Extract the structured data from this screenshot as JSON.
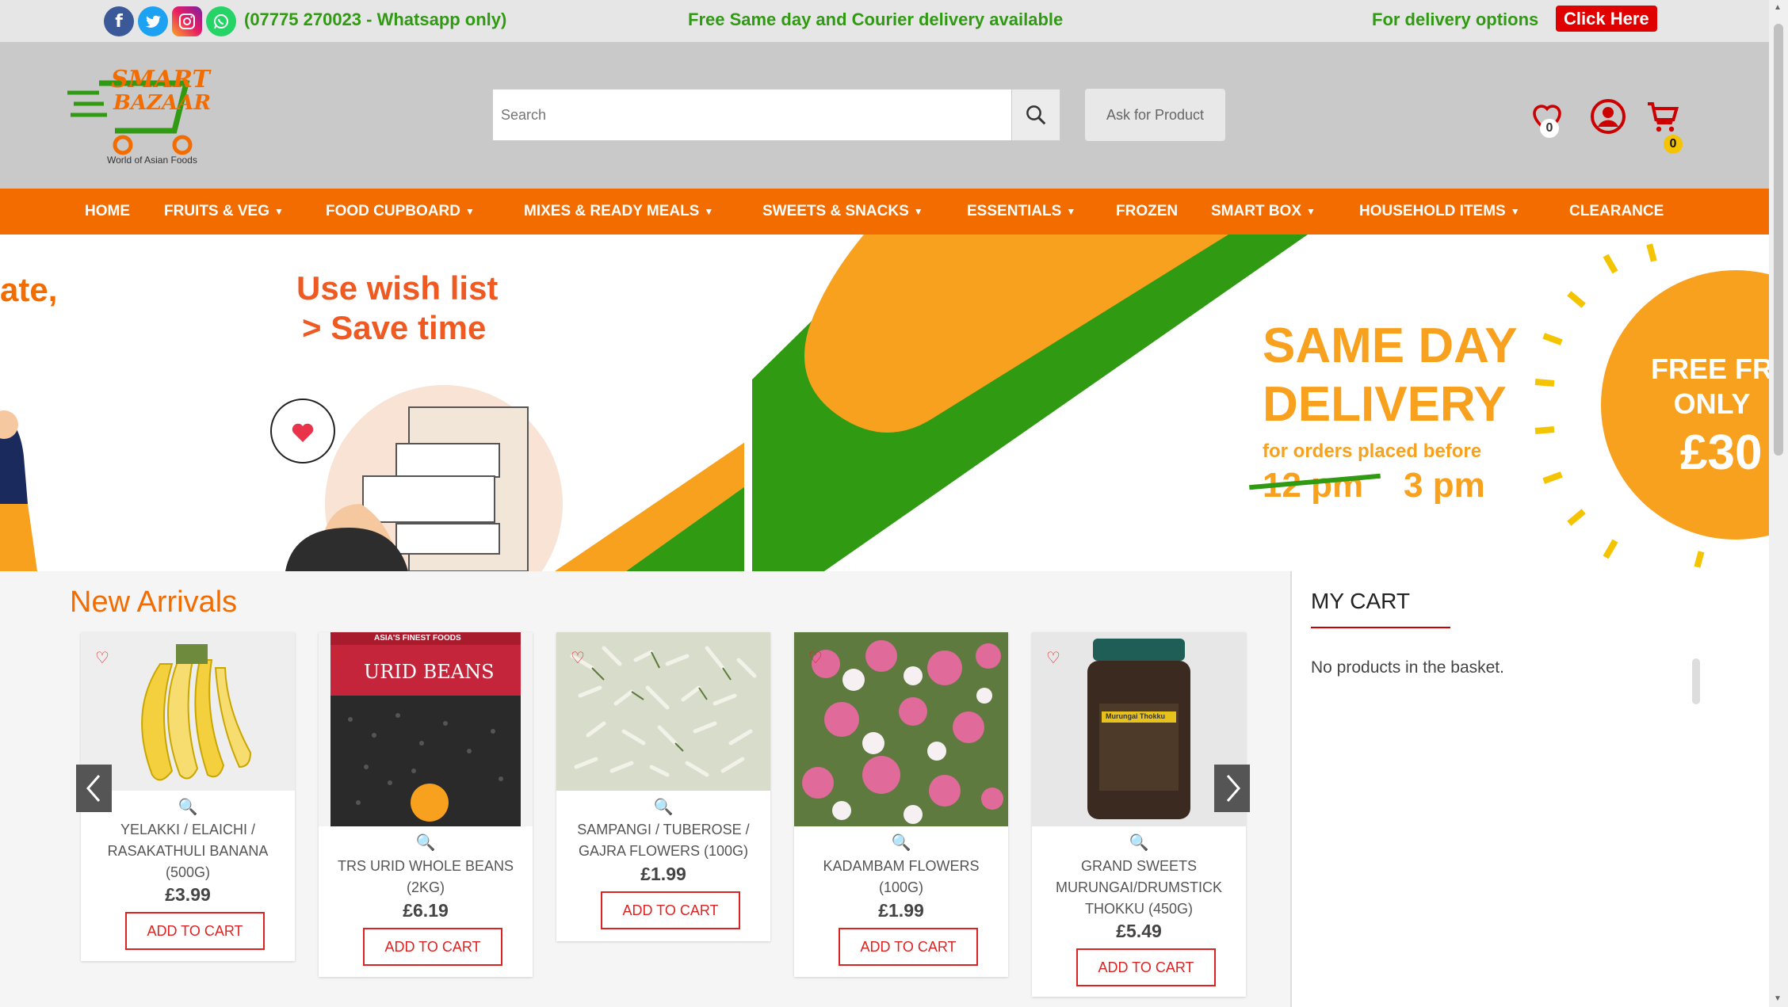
{
  "topbar": {
    "phone": "(07775 270023 - Whatsapp only)",
    "promo": "Free Same day and Courier delivery available",
    "delivery_label": "For delivery options",
    "click_here": "Click Here"
  },
  "header": {
    "logo_line1": "SMART",
    "logo_line2": "BAZAAR",
    "logo_tagline": "World of Asian Foods",
    "search_placeholder": "Search",
    "ask_button": "Ask for Product",
    "wishlist_count": "0",
    "cart_count": "0"
  },
  "nav": {
    "items": [
      {
        "label": "HOME"
      },
      {
        "label": "FRUITS & VEG"
      },
      {
        "label": "FOOD CUPBOARD"
      },
      {
        "label": "MIXES & READY MEALS"
      },
      {
        "label": "SWEETS & SNACKS"
      },
      {
        "label": "ESSENTIALS"
      },
      {
        "label": "FROZEN"
      },
      {
        "label": "SMART BOX"
      },
      {
        "label": "HOUSEHOLD ITEMS"
      },
      {
        "label": "CLEARANCE"
      }
    ]
  },
  "banner": {
    "left_fragment": "ate,",
    "wish_line1": "Use wish list",
    "wish_line2": "> Save time",
    "sameday_line1": "SAME DAY",
    "sameday_line2": "DELIVERY",
    "orders_text": "for orders placed before",
    "old_time": "12 pm",
    "new_time": "3 pm",
    "free_line1": "FREE FR",
    "free_line2": "ONLY",
    "price": "£30"
  },
  "new_arrivals": {
    "title": "New Arrivals",
    "add_to_cart": "ADD TO CART",
    "products": [
      {
        "name": "YELAKKI / ELAICHI / RASAKATHULI BANANA (500G)",
        "price": "£3.99"
      },
      {
        "name": "TRS URID WHOLE BEANS (2KG)",
        "price": "£6.19",
        "bag_brand": "ASIA'S FINEST FOODS",
        "bag_label": "URID BEANS"
      },
      {
        "name": "SAMPANGI / TUBEROSE / GAJRA FLOWERS (100G)",
        "price": "£1.99"
      },
      {
        "name": "KADAMBAM FLOWERS (100G)",
        "price": "£1.99"
      },
      {
        "name": "GRAND SWEETS MURUNGAI/DRUMSTICK THOKKU (450G)",
        "price": "£5.49",
        "jar_label": "Murungai Thokku"
      }
    ]
  },
  "cart": {
    "title": "MY CART",
    "empty_message": "No products in the basket."
  },
  "colors": {
    "brand_orange": "#f36c00",
    "brand_green": "#2f9a12",
    "accent_red": "#e00000",
    "banner_yellow": "#f7a11e"
  }
}
